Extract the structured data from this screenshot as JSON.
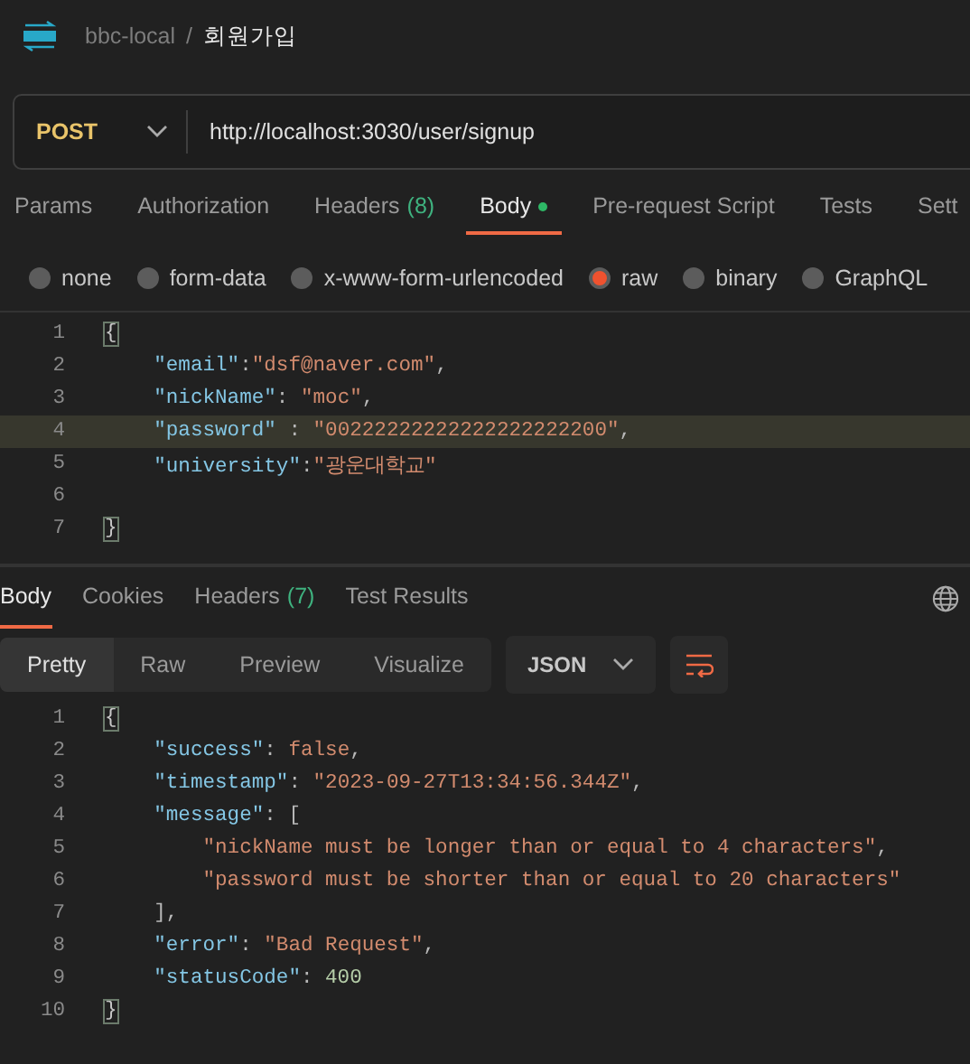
{
  "breadcrumb": {
    "collection": "bbc-local",
    "separator": "/",
    "request": "회원가입"
  },
  "request": {
    "method": "POST",
    "url": "http://localhost:3030/user/signup"
  },
  "tabs": [
    {
      "label": "Params",
      "selected": false
    },
    {
      "label": "Authorization",
      "selected": false
    },
    {
      "label": "Headers",
      "count": "(8)",
      "selected": false
    },
    {
      "label": "Body",
      "dot": true,
      "selected": true
    },
    {
      "label": "Pre-request Script",
      "selected": false
    },
    {
      "label": "Tests",
      "selected": false
    },
    {
      "label": "Sett",
      "selected": false
    }
  ],
  "body_types": [
    {
      "label": "none",
      "selected": false
    },
    {
      "label": "form-data",
      "selected": false
    },
    {
      "label": "x-www-form-urlencoded",
      "selected": false
    },
    {
      "label": "raw",
      "selected": true
    },
    {
      "label": "binary",
      "selected": false
    },
    {
      "label": "GraphQL",
      "selected": false
    }
  ],
  "request_body": [
    {
      "number": "1",
      "highlighted": false,
      "tokens": [
        {
          "kind": "brace",
          "text": "{"
        }
      ]
    },
    {
      "number": "2",
      "highlighted": false,
      "tokens": [
        {
          "kind": "key",
          "text": "    \"email\""
        },
        {
          "kind": "punct",
          "text": ":"
        },
        {
          "kind": "string",
          "text": "\"dsf@naver.com\""
        },
        {
          "kind": "punct",
          "text": ","
        }
      ]
    },
    {
      "number": "3",
      "highlighted": false,
      "tokens": [
        {
          "kind": "key",
          "text": "    \"nickName\""
        },
        {
          "kind": "punct",
          "text": ": "
        },
        {
          "kind": "string",
          "text": "\"moc\""
        },
        {
          "kind": "punct",
          "text": ","
        }
      ]
    },
    {
      "number": "4",
      "highlighted": true,
      "tokens": [
        {
          "kind": "key",
          "text": "    \"password\""
        },
        {
          "kind": "punct",
          "text": " : "
        },
        {
          "kind": "string",
          "text": "\"00222222222222222222200\""
        },
        {
          "kind": "punct",
          "text": ","
        }
      ]
    },
    {
      "number": "5",
      "highlighted": false,
      "tokens": [
        {
          "kind": "key",
          "text": "    \"university\""
        },
        {
          "kind": "punct",
          "text": ":"
        },
        {
          "kind": "string",
          "text": "\"광운대학교\""
        }
      ]
    },
    {
      "number": "6",
      "highlighted": false
    },
    {
      "number": "7",
      "highlighted": false,
      "tokens": [
        {
          "kind": "brace",
          "text": "}"
        }
      ]
    }
  ],
  "response_tabs": [
    {
      "label": "Body",
      "selected": true
    },
    {
      "label": "Cookies",
      "selected": false
    },
    {
      "label": "Headers",
      "count": "(7)",
      "selected": false
    },
    {
      "label": "Test Results",
      "selected": false
    }
  ],
  "view_modes": [
    {
      "label": "Pretty",
      "selected": true
    },
    {
      "label": "Raw",
      "selected": false
    },
    {
      "label": "Preview",
      "selected": false
    },
    {
      "label": "Visualize",
      "selected": false
    }
  ],
  "format": "JSON",
  "response_body": [
    {
      "number": "1",
      "tokens": [
        {
          "kind": "brace",
          "text": "{"
        }
      ]
    },
    {
      "number": "2",
      "tokens": [
        {
          "kind": "key",
          "text": "    \"success\""
        },
        {
          "kind": "punct",
          "text": ": "
        },
        {
          "kind": "bool",
          "text": "false"
        },
        {
          "kind": "punct",
          "text": ","
        }
      ]
    },
    {
      "number": "3",
      "tokens": [
        {
          "kind": "key",
          "text": "    \"timestamp\""
        },
        {
          "kind": "punct",
          "text": ": "
        },
        {
          "kind": "string",
          "text": "\"2023-09-27T13:34:56.344Z\""
        },
        {
          "kind": "punct",
          "text": ","
        }
      ]
    },
    {
      "number": "4",
      "tokens": [
        {
          "kind": "key",
          "text": "    \"message\""
        },
        {
          "kind": "punct",
          "text": ": ["
        }
      ]
    },
    {
      "number": "5",
      "tokens": [
        {
          "kind": "string",
          "text": "        \"nickName must be longer than or equal to 4 characters\""
        },
        {
          "kind": "punct",
          "text": ","
        }
      ]
    },
    {
      "number": "6",
      "tokens": [
        {
          "kind": "string",
          "text": "        \"password must be shorter than or equal to 20 characters\""
        }
      ]
    },
    {
      "number": "7",
      "tokens": [
        {
          "kind": "punct",
          "text": "    ],"
        }
      ]
    },
    {
      "number": "8",
      "tokens": [
        {
          "kind": "key",
          "text": "    \"error\""
        },
        {
          "kind": "punct",
          "text": ": "
        },
        {
          "kind": "string",
          "text": "\"Bad Request\""
        },
        {
          "kind": "punct",
          "text": ","
        }
      ]
    },
    {
      "number": "9",
      "tokens": [
        {
          "kind": "key",
          "text": "    \"statusCode\""
        },
        {
          "kind": "punct",
          "text": ": "
        },
        {
          "kind": "number",
          "text": "400"
        }
      ]
    },
    {
      "number": "10",
      "tokens": [
        {
          "kind": "brace",
          "text": "}"
        }
      ]
    }
  ]
}
